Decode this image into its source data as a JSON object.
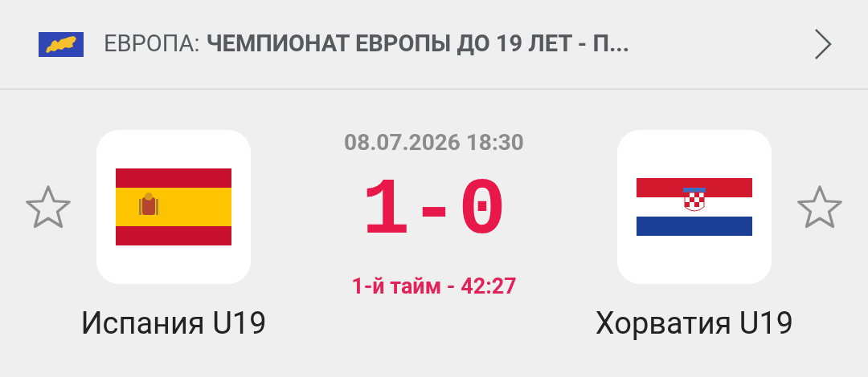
{
  "header": {
    "region": "ЕВРОПА:",
    "tournament": "ЧЕМПИОНАТ ЕВРОПЫ ДО 19 ЛЕТ - П..."
  },
  "match": {
    "datetime": "08.07.2026 18:30",
    "score": "1-0",
    "period": "1-й тайм - 42:27"
  },
  "teams": [
    {
      "name": "Испания U19",
      "kind": "spain",
      "favorite": false
    },
    {
      "name": "Хорватия U19",
      "kind": "croatia",
      "favorite": false
    }
  ]
}
